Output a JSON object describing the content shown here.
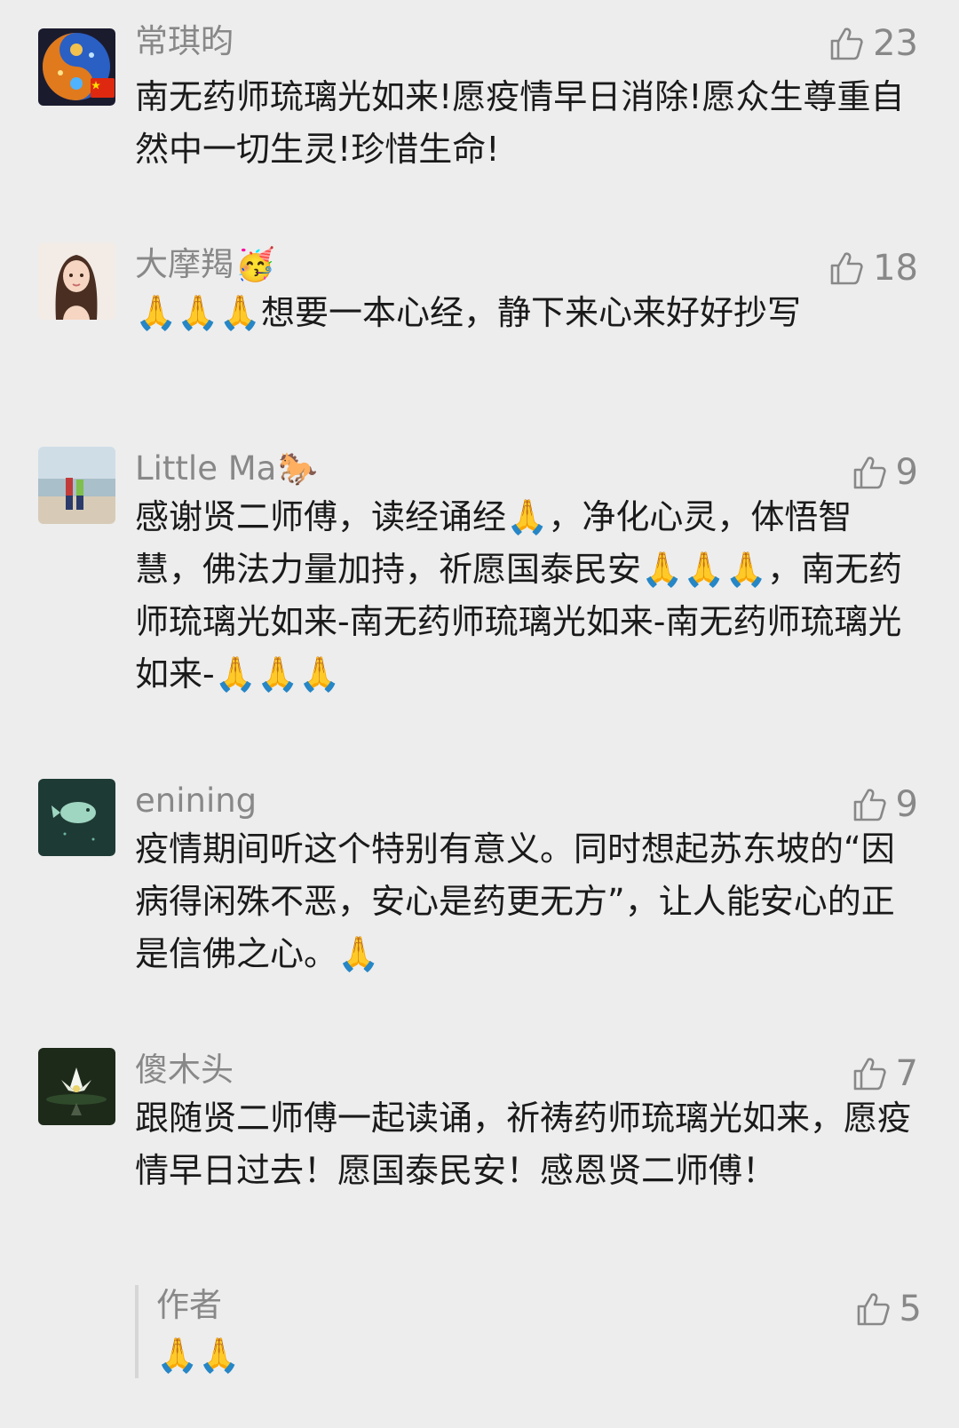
{
  "comments": [
    {
      "name": "常琪昀",
      "name_emoji": "",
      "avatar": "yin-yang-galaxy-avatar",
      "likes": "23",
      "text": "南无药师琉璃光如来!愿疫情早日消除!愿众生尊重自然中一切生灵!珍惜生命!"
    },
    {
      "name": "大摩羯",
      "name_emoji": "🥳",
      "avatar": "anime-girl-avatar",
      "likes": "18",
      "text": "🙏🙏🙏想要一本心经，静下来心来好好抄写"
    },
    {
      "name": "Little Ma",
      "name_emoji": "🐎",
      "avatar": "beach-couple-avatar",
      "likes": "9",
      "text": "感谢贤二师傅，读经诵经🙏，净化心灵，体悟智慧，佛法力量加持，祈愿国泰民安🙏🙏🙏，南无药师琉璃光如来-南无药师琉璃光如来-南无药师琉璃光如来-🙏🙏🙏"
    },
    {
      "name": "enining",
      "name_emoji": "",
      "avatar": "dolphin-avatar",
      "likes": "9",
      "text": "疫情期间听这个特别有意义。同时想起苏东坡的“因病得闲殊不恶，安心是药更无方”，让人能安心的正是信佛之心。🙏"
    },
    {
      "name": "傻木头",
      "name_emoji": "",
      "avatar": "lotus-flower-avatar",
      "likes": "7",
      "text": "跟随贤二师傅一起读诵，祈祷药师琉璃光如来，愿疫情早日过去！愿国泰民安！感恩贤二师傅！"
    }
  ],
  "author_reply": {
    "name": "作者",
    "likes": "5",
    "text": "🙏🙏"
  },
  "icons": {
    "like": "thumbs-up-icon",
    "flag": "china-flag-icon"
  },
  "colors": {
    "background": "#ededed",
    "secondary_text": "#888888",
    "primary_text": "#1a1a1a",
    "reply_bar": "#d6d6d6"
  }
}
